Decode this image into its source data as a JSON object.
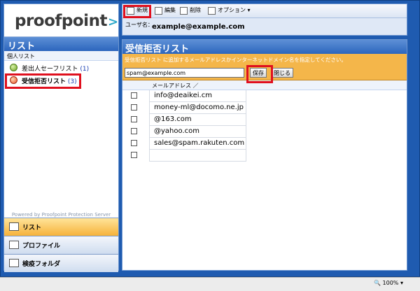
{
  "brand": {
    "logo_text": "proofpoint",
    "logo_mark": ">"
  },
  "sidebar": {
    "heading": "リスト",
    "subheading": "個人リスト",
    "items": [
      {
        "label": "差出人セーフリスト",
        "count": "(1)"
      },
      {
        "label": "受信拒否リスト",
        "count": "(3)"
      }
    ],
    "powered_by": "Powered by Proofpoint Protection Server",
    "nav": [
      {
        "label": "リスト"
      },
      {
        "label": "プロファイル"
      },
      {
        "label": "検疫フォルダ"
      }
    ]
  },
  "toolbar": {
    "new_label": "新規",
    "edit_label": "編集",
    "delete_label": "削除",
    "options_label": "オプション"
  },
  "user": {
    "label": "ユーザ名：",
    "value": "example@example.com"
  },
  "main": {
    "title": "受信拒否リスト",
    "description": "受信拒否リスト に追加するメールアドレスかインターネットドメイン名を指定してください。",
    "entry_value": "spam@example.com",
    "save_label": "保存",
    "close_label": "閉じる",
    "column_header": "メールアドレス ／",
    "rows": [
      "info@deaikei.cm",
      "money-ml@docomo.ne.jp",
      "@163.com",
      "@yahoo.com",
      "sales@spam.rakuten.com",
      ""
    ]
  },
  "status": {
    "zoom": "100%"
  },
  "colors": {
    "highlight": "#e0101e",
    "form_band": "#f4b64a",
    "header_blue": "#2c66bd"
  }
}
